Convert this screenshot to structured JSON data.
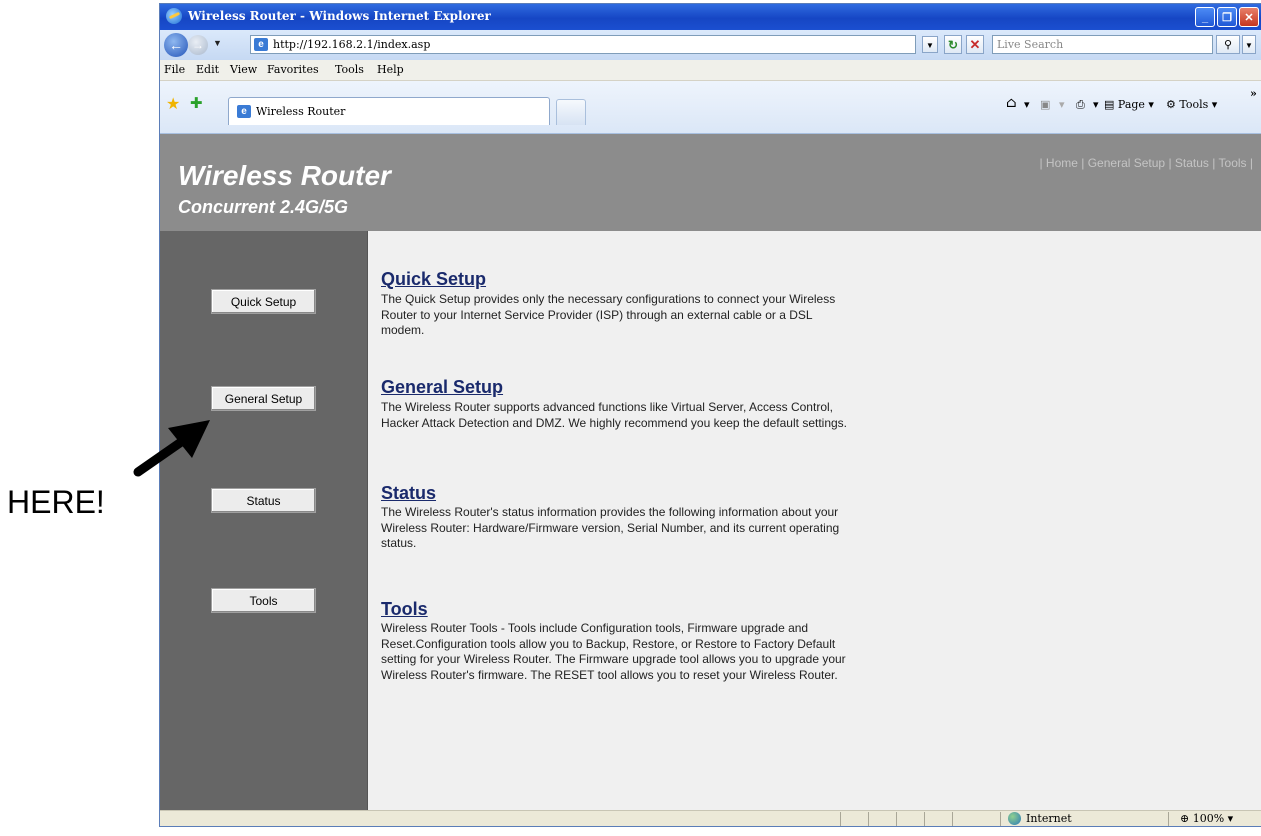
{
  "window": {
    "title": "Wireless Router - Windows Internet Explorer",
    "controls": {
      "minimize": "_",
      "maximize": "❐",
      "close": "✕"
    }
  },
  "address_bar": {
    "url": "http://192.168.2.1/index.asp",
    "search_placeholder": "Live Search",
    "icons": [
      "back-icon",
      "forward-icon",
      "refresh-icon",
      "stop-icon",
      "search-icon"
    ]
  },
  "menu": [
    "File",
    "Edit",
    "View",
    "Favorites",
    "Tools",
    "Help"
  ],
  "tabs": [
    {
      "label": "Wireless Router",
      "active": true
    }
  ],
  "command_bar": {
    "page": "Page",
    "tools": "Tools",
    "overflow": "»"
  },
  "router": {
    "title": "Wireless Router",
    "subtitle": "Concurrent 2.4G/5G",
    "top_nav": [
      "Home",
      "General Setup",
      "Status",
      "Tools"
    ],
    "sidebar_buttons": [
      "Quick Setup",
      "General Setup",
      "Status",
      "Tools"
    ],
    "sections": [
      {
        "title": "Quick Setup",
        "description": "The Quick Setup provides only the necessary configurations to connect your Wireless Router to your Internet Service Provider (ISP) through an external cable or a DSL modem."
      },
      {
        "title": "General Setup",
        "description": "The Wireless Router supports advanced functions like Virtual Server, Access Control, Hacker Attack Detection and DMZ. We highly recommend you keep the default settings."
      },
      {
        "title": "Status",
        "description": "The Wireless Router's status information provides the following information about your Wireless Router: Hardware/Firmware version, Serial Number, and its current operating status."
      },
      {
        "title": "Tools",
        "description": "Wireless Router Tools - Tools include Configuration tools, Firmware upgrade and Reset.Configuration tools allow you to Backup, Restore, or Restore to Factory Default setting for your Wireless Router. The Firmware upgrade tool allows you to upgrade your Wireless Router's firmware. The RESET tool allows you to reset your Wireless Router."
      }
    ]
  },
  "status_bar": {
    "zone": "Internet",
    "zoom": "100%"
  },
  "annotation": {
    "label": "HERE!"
  },
  "colors": {
    "title_bar": "#1a4fd0",
    "header_bg": "#8c8c8c",
    "sidebar_bg": "#666666",
    "content_bg": "#f0f0f0",
    "link_color": "#1a2a6c"
  }
}
